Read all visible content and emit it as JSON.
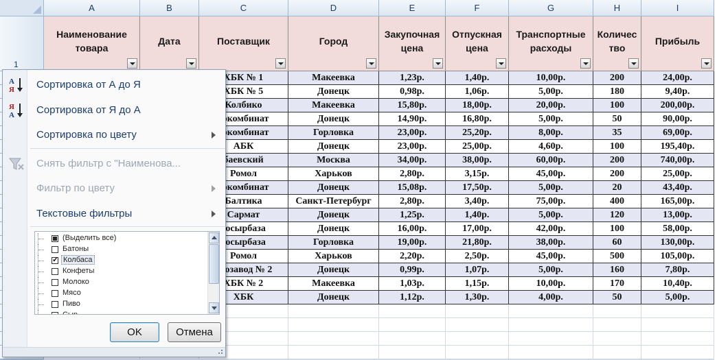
{
  "columns": [
    "A",
    "B",
    "C",
    "D",
    "E",
    "F",
    "G",
    "H",
    "I"
  ],
  "row_numbers": [
    "1"
  ],
  "headers": [
    "Наименование\nтовара",
    "Дата",
    "Поставщик",
    "Город",
    "Закупочная\nцена",
    "Отпускная\nцена",
    "Транспортные\nрасходы",
    "Количес\nтво",
    "Прибыль"
  ],
  "rows": [
    [
      "ХБК № 1",
      "Макеевка",
      "1,23р.",
      "1,40р.",
      "10,00р.",
      "200",
      "24,00р."
    ],
    [
      "ХБК № 5",
      "Донецк",
      "0,98р.",
      "1,06р.",
      "5,00р.",
      "180",
      "9,40р."
    ],
    [
      "Колбико",
      "Макеевка",
      "15,80р.",
      "18,00р.",
      "20,00р.",
      "100",
      "200,00р."
    ],
    [
      "сокомбинат",
      "Донецк",
      "14,90р.",
      "16,80р.",
      "5,00р.",
      "50",
      "90,00р."
    ],
    [
      "сокомбинат",
      "Горловка",
      "23,00р.",
      "25,20р.",
      "8,00р.",
      "35",
      "69,00р."
    ],
    [
      "АБК",
      "Донецк",
      "23,00р.",
      "25,00р.",
      "4,60р.",
      "100",
      "195,40р."
    ],
    [
      "баевский",
      "Москва",
      "34,00р.",
      "38,00р.",
      "60,00р.",
      "200",
      "740,00р."
    ],
    [
      "Ромол",
      "Харьков",
      "2,80р.",
      "3,15р.",
      "45,00р.",
      "200",
      "25,00р."
    ],
    [
      "сокомбинат",
      "Донецк",
      "15,08р.",
      "17,50р.",
      "5,00р.",
      "20",
      "43,40р."
    ],
    [
      "Балтика",
      "Санкт-Петербург",
      "2,80р.",
      "3,40р.",
      "75,00р.",
      "400",
      "165,00р."
    ],
    [
      "Сармат",
      "Донецк",
      "1,25р.",
      "1,40р.",
      "5,00р.",
      "120",
      "13,00р."
    ],
    [
      "сосырбаза",
      "Донецк",
      "16,00р.",
      "17,00р.",
      "42,00р.",
      "100",
      "58,00р."
    ],
    [
      "сосырбаза",
      "Горловка",
      "19,00р.",
      "21,80р.",
      "38,00р.",
      "60",
      "130,00р."
    ],
    [
      "Ромол",
      "Харьков",
      "2,20р.",
      "2,50р.",
      "45,00р.",
      "500",
      "105,00р."
    ],
    [
      "окозавод № 2",
      "Донецк",
      "0,99р.",
      "1,07р.",
      "5,00р.",
      "160",
      "7,80р."
    ],
    [
      "ХБК № 2",
      "Макеевка",
      "1,03р.",
      "1,15р.",
      "10,00р.",
      "170",
      "10,40р."
    ],
    [
      "ХБК",
      "Донецк",
      "1,12р.",
      "1,30р.",
      "4,00р.",
      "50",
      "5,00р."
    ]
  ],
  "menu": {
    "sort_az": "Сортировка от А до Я",
    "sort_za": "Сортировка от Я до А",
    "sort_color": "Сортировка по цвету",
    "clear_filter": "Снять фильтр с \"Наименова...",
    "filter_color": "Фильтр по цвету",
    "text_filters": "Текстовые фильтры"
  },
  "values": [
    {
      "label": "(Выделить все)",
      "state": "partial"
    },
    {
      "label": "Батоны",
      "state": "unchecked"
    },
    {
      "label": "Колбаса",
      "state": "checked"
    },
    {
      "label": "Конфеты",
      "state": "unchecked"
    },
    {
      "label": "Молоко",
      "state": "unchecked"
    },
    {
      "label": "Мясо",
      "state": "unchecked"
    },
    {
      "label": "Пиво",
      "state": "unchecked"
    },
    {
      "label": "Сыр",
      "state": "unchecked"
    }
  ],
  "buttons": {
    "ok": "OK",
    "cancel": "Отмена"
  },
  "colors": {
    "header_fill": "#f2dcdb",
    "band_fill": "#e4e7f3",
    "menu_text": "#1b3d70"
  }
}
